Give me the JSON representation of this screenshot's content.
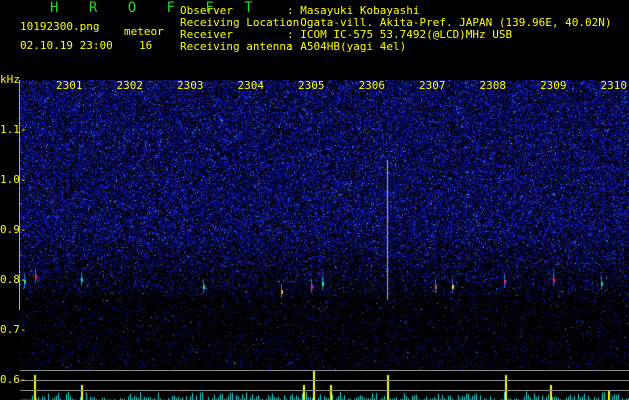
{
  "app_title": "H R O F F T",
  "file_name": "10192300.png",
  "datetime": "02.10.19 23:00",
  "meteor_label": "meteor",
  "meteor_count": "16",
  "info": [
    {
      "label": "Observer",
      "value": ": Masayuki Kobayashi"
    },
    {
      "label": "Receiving Location",
      "value": ": Ogata-vill. Akita-Pref. JAPAN (139.96E, 40.02N)"
    },
    {
      "label": "Receiver",
      "value": ": ICOM IC-575 53.7492(@LCD)MHz USB"
    },
    {
      "label": "Receiving antenna",
      "value": ": A504HB(yagi 4el)"
    }
  ],
  "y_unit": "kHz",
  "y_ticks": [
    "1.1",
    "1.0",
    "0.9",
    "0.8",
    "0.7",
    "0.6"
  ],
  "x_ticks": [
    "2301",
    "2302",
    "2303",
    "2304",
    "2305",
    "2306",
    "2307",
    "2308",
    "2309",
    "2310"
  ],
  "colors": {
    "text": "#ffff00",
    "title": "#22dd22",
    "noise": "#1a22cc",
    "histogram": "#22dddd",
    "meteor_bar": "#ffff00"
  }
}
